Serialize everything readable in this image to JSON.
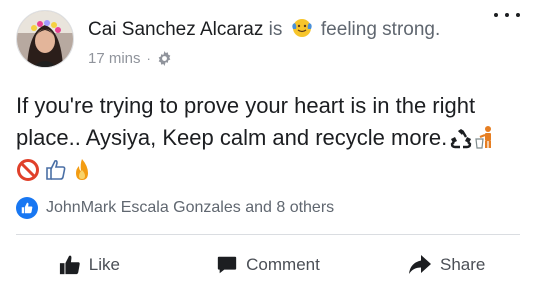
{
  "post": {
    "author": "Cai Sanchez Alcaraz",
    "is_word": "is",
    "feeling": "feeling strong.",
    "time": "17 mins",
    "separator": "·",
    "text_line1": "If you're trying to prove your heart is in the right",
    "text_line2": "place.. Aysiya, Keep calm and recycle more.",
    "feeling_emoji_icon": "flexing-face-emoji-icon",
    "privacy_icon": "gear-icon",
    "text_icons": [
      "recycle-icon",
      "litter-in-bin-icon"
    ],
    "emoji_row_icons": [
      "no-entry-icon",
      "thumbs-up-outline-icon",
      "fire-icon"
    ]
  },
  "reactions": {
    "summary": "JohnMark Escala Gonzales and 8 others",
    "icon": "like-badge-icon",
    "accent": "#1877f2"
  },
  "actions": {
    "like": "Like",
    "comment": "Comment",
    "share": "Share"
  }
}
